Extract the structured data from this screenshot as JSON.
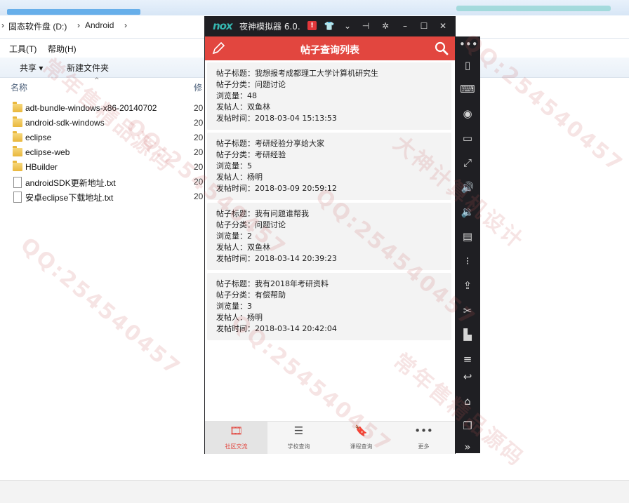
{
  "explorer": {
    "breadcrumb": [
      "固态软件盘 (D:)",
      "Android"
    ],
    "menu": [
      "工具(T)",
      "帮助(H)"
    ],
    "toolbar": {
      "share_label": "共享",
      "new_folder_label": "新建文件夹"
    },
    "columns": {
      "name": "名称",
      "modified": "修"
    },
    "files": [
      {
        "name": "adt-bundle-windows-x86-20140702",
        "type": "folder",
        "date": "20"
      },
      {
        "name": "android-sdk-windows",
        "type": "folder",
        "date": "20"
      },
      {
        "name": "eclipse",
        "type": "folder",
        "date": "20"
      },
      {
        "name": "eclipse-web",
        "type": "folder",
        "date": "20"
      },
      {
        "name": "HBuilder",
        "type": "folder",
        "date": "20"
      },
      {
        "name": "androidSDK更新地址.txt",
        "type": "txt",
        "date": "20"
      },
      {
        "name": "安卓eclipse下载地址.txt",
        "type": "txt",
        "date": "20"
      }
    ]
  },
  "emulator": {
    "logo": "nox",
    "title": "夜神模拟器 6.0.",
    "alert_badge": "!",
    "titlebar_icons": [
      "shirt-icon",
      "chevron-down-icon",
      "pin-icon",
      "gear-icon",
      "minimize-icon",
      "maximize-icon",
      "close-icon"
    ],
    "sidebar_icons": [
      "more-icon",
      "shake-icon",
      "keyboard-icon",
      "location-icon",
      "screen-icon",
      "fullscreen-icon",
      "volume-up-icon",
      "volume-down-icon",
      "apk-install-icon",
      "macro-icon",
      "import-icon",
      "scissors-icon",
      "multi-instance-icon",
      "menu-icon",
      "back-icon",
      "home-icon",
      "recent-icon",
      "expand-icon"
    ]
  },
  "app": {
    "title": "帖子查询列表",
    "accent_color": "#e2463f",
    "posts": [
      {
        "title_line": "帖子标题：我想报考成都理工大学计算机研究生",
        "category_line": "帖子分类：问题讨论",
        "views_line": "浏览量：48",
        "author_line": "发帖人：双鱼林",
        "time_line": "发帖时间：2018-03-04 15:13:53"
      },
      {
        "title_line": "帖子标题：考研经验分享给大家",
        "category_line": "帖子分类：考研经验",
        "views_line": "浏览量：5",
        "author_line": "发帖人：杨明",
        "time_line": "发帖时间：2018-03-09 20:59:12"
      },
      {
        "title_line": "帖子标题：我有问题谁帮我",
        "category_line": "帖子分类：问题讨论",
        "views_line": "浏览量：2",
        "author_line": "发帖人：双鱼林",
        "time_line": "发帖时间：2018-03-14 20:39:23"
      },
      {
        "title_line": "帖子标题：我有2018年考研资料",
        "category_line": "帖子分类：有偿帮助",
        "views_line": "浏览量：3",
        "author_line": "发帖人：杨明",
        "time_line": "发帖时间：2018-03-14 20:42:04"
      }
    ],
    "tabs": [
      {
        "label": "社区交流",
        "icon": "film-icon",
        "active": true
      },
      {
        "label": "学校查询",
        "icon": "school-icon",
        "active": false
      },
      {
        "label": "课程查询",
        "icon": "bookmark-icon",
        "active": false
      },
      {
        "label": "更多",
        "icon": "more-dots-icon",
        "active": false
      }
    ]
  },
  "watermark": {
    "texts": [
      "QQ:254540457",
      "大神计算机设计",
      "常年售精品源码"
    ]
  }
}
